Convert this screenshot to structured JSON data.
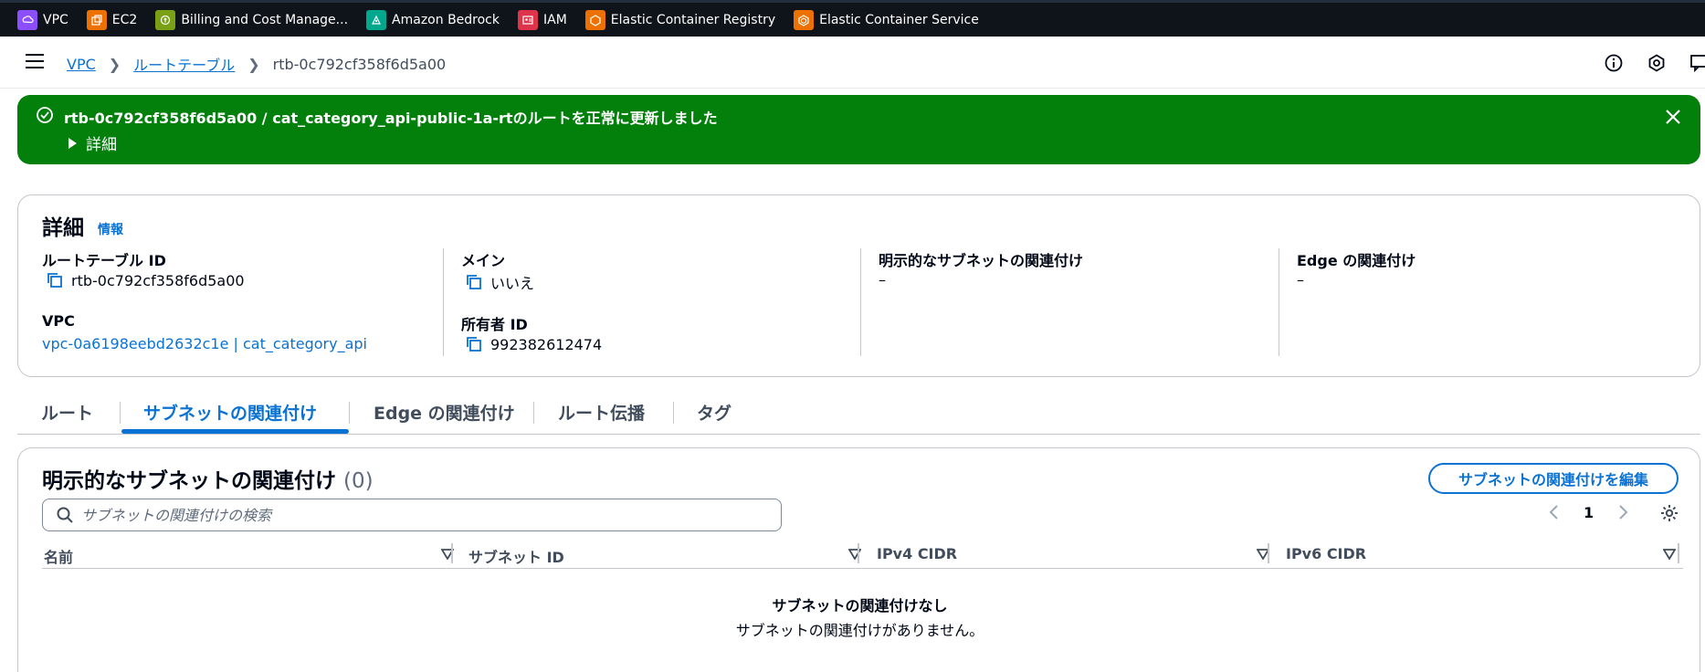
{
  "favorites": [
    {
      "label": "VPC",
      "icon": "vpc-icon",
      "color": "#8c4fff"
    },
    {
      "label": "EC2",
      "icon": "ec2-icon",
      "color": "#ed7100"
    },
    {
      "label": "Billing and Cost Manage...",
      "icon": "billing-icon",
      "color": "#7aa116"
    },
    {
      "label": "Amazon Bedrock",
      "icon": "bedrock-icon",
      "color": "#01a88d"
    },
    {
      "label": "IAM",
      "icon": "iam-icon",
      "color": "#dd344c"
    },
    {
      "label": "Elastic Container Registry",
      "icon": "ecr-icon",
      "color": "#ed7100"
    },
    {
      "label": "Elastic Container Service",
      "icon": "ecs-icon",
      "color": "#ed7100"
    }
  ],
  "breadcrumb": {
    "items": [
      "VPC",
      "ルートテーブル"
    ],
    "current": "rtb-0c792cf358f6d5a00"
  },
  "flash": {
    "message": "rtb-0c792cf358f6d5a00 / cat_category_api-public-1a-rtのルートを正常に更新しました",
    "details_label": "詳細",
    "color": "#037f0c"
  },
  "details": {
    "title": "詳細",
    "info_label": "情報",
    "route_table_id_label": "ルートテーブル ID",
    "route_table_id": "rtb-0c792cf358f6d5a00",
    "vpc_label": "VPC",
    "vpc_value": "vpc-0a6198eebd2632c1e | cat_category_api",
    "main_label": "メイン",
    "main_value": "いいえ",
    "owner_label": "所有者 ID",
    "owner_value": "992382612474",
    "explicit_subnet_label": "明示的なサブネットの関連付け",
    "explicit_subnet_value": "–",
    "edge_label": "Edge の関連付け",
    "edge_value": "–"
  },
  "tabs": [
    "ルート",
    "サブネットの関連付け",
    "Edge の関連付け",
    "ルート伝播",
    "タグ"
  ],
  "active_tab": "サブネットの関連付け",
  "subnet_table": {
    "title": "明示的なサブネットの関連付け",
    "count": "(0)",
    "edit_button": "サブネットの関連付けを編集",
    "search_placeholder": "サブネットの関連付けの検索",
    "page": "1",
    "columns": [
      "名前",
      "サブネット ID",
      "IPv4 CIDR",
      "IPv6 CIDR"
    ],
    "empty_title": "サブネットの関連付けなし",
    "empty_desc": "サブネットの関連付けがありません。"
  },
  "colors": {
    "link": "#0972d3",
    "nav_bg": "#0f141a"
  }
}
